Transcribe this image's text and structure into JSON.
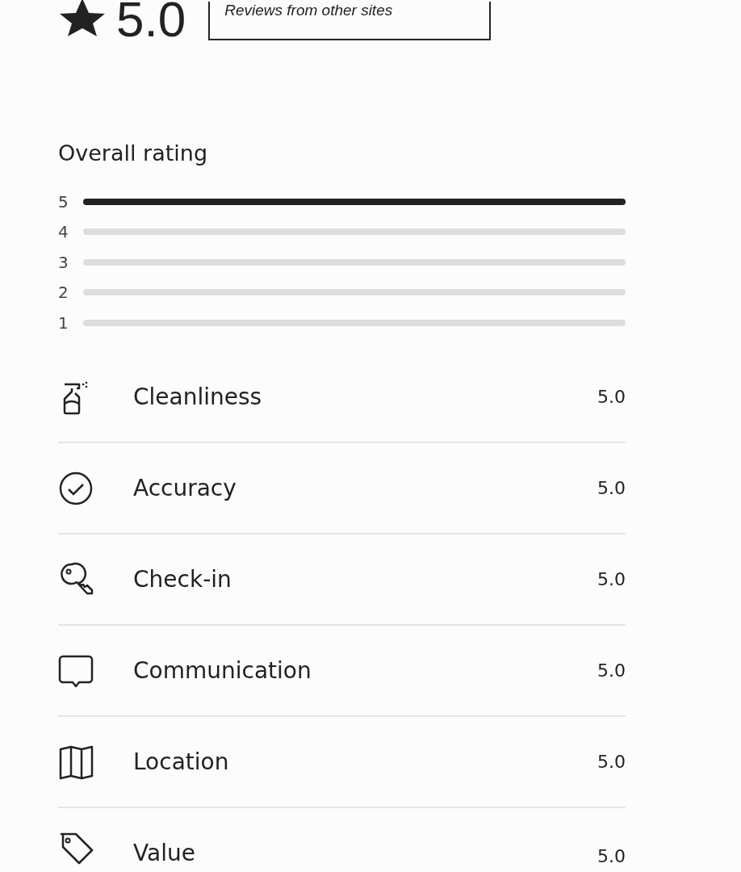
{
  "summary": {
    "score": "5.0",
    "other_sites_box": {
      "label": "Reviews from other sites"
    }
  },
  "overall_rating": {
    "title": "Overall rating",
    "bars": [
      {
        "label": "5",
        "level": 1
      },
      {
        "label": "4",
        "level": 0
      },
      {
        "label": "3",
        "level": 0
      },
      {
        "label": "2",
        "level": 0
      },
      {
        "label": "1",
        "level": 0
      }
    ]
  },
  "categories": [
    {
      "kind": "spray",
      "label": "Cleanliness",
      "score": "5.0"
    },
    {
      "kind": "check",
      "label": "Accuracy",
      "score": "5.0"
    },
    {
      "kind": "key",
      "label": "Check-in",
      "score": "5.0"
    },
    {
      "kind": "chat",
      "label": "Communication",
      "score": "5.0"
    },
    {
      "kind": "map",
      "label": "Location",
      "score": "5.0"
    },
    {
      "kind": "tag",
      "label": "Value",
      "score": "5.0"
    }
  ]
}
